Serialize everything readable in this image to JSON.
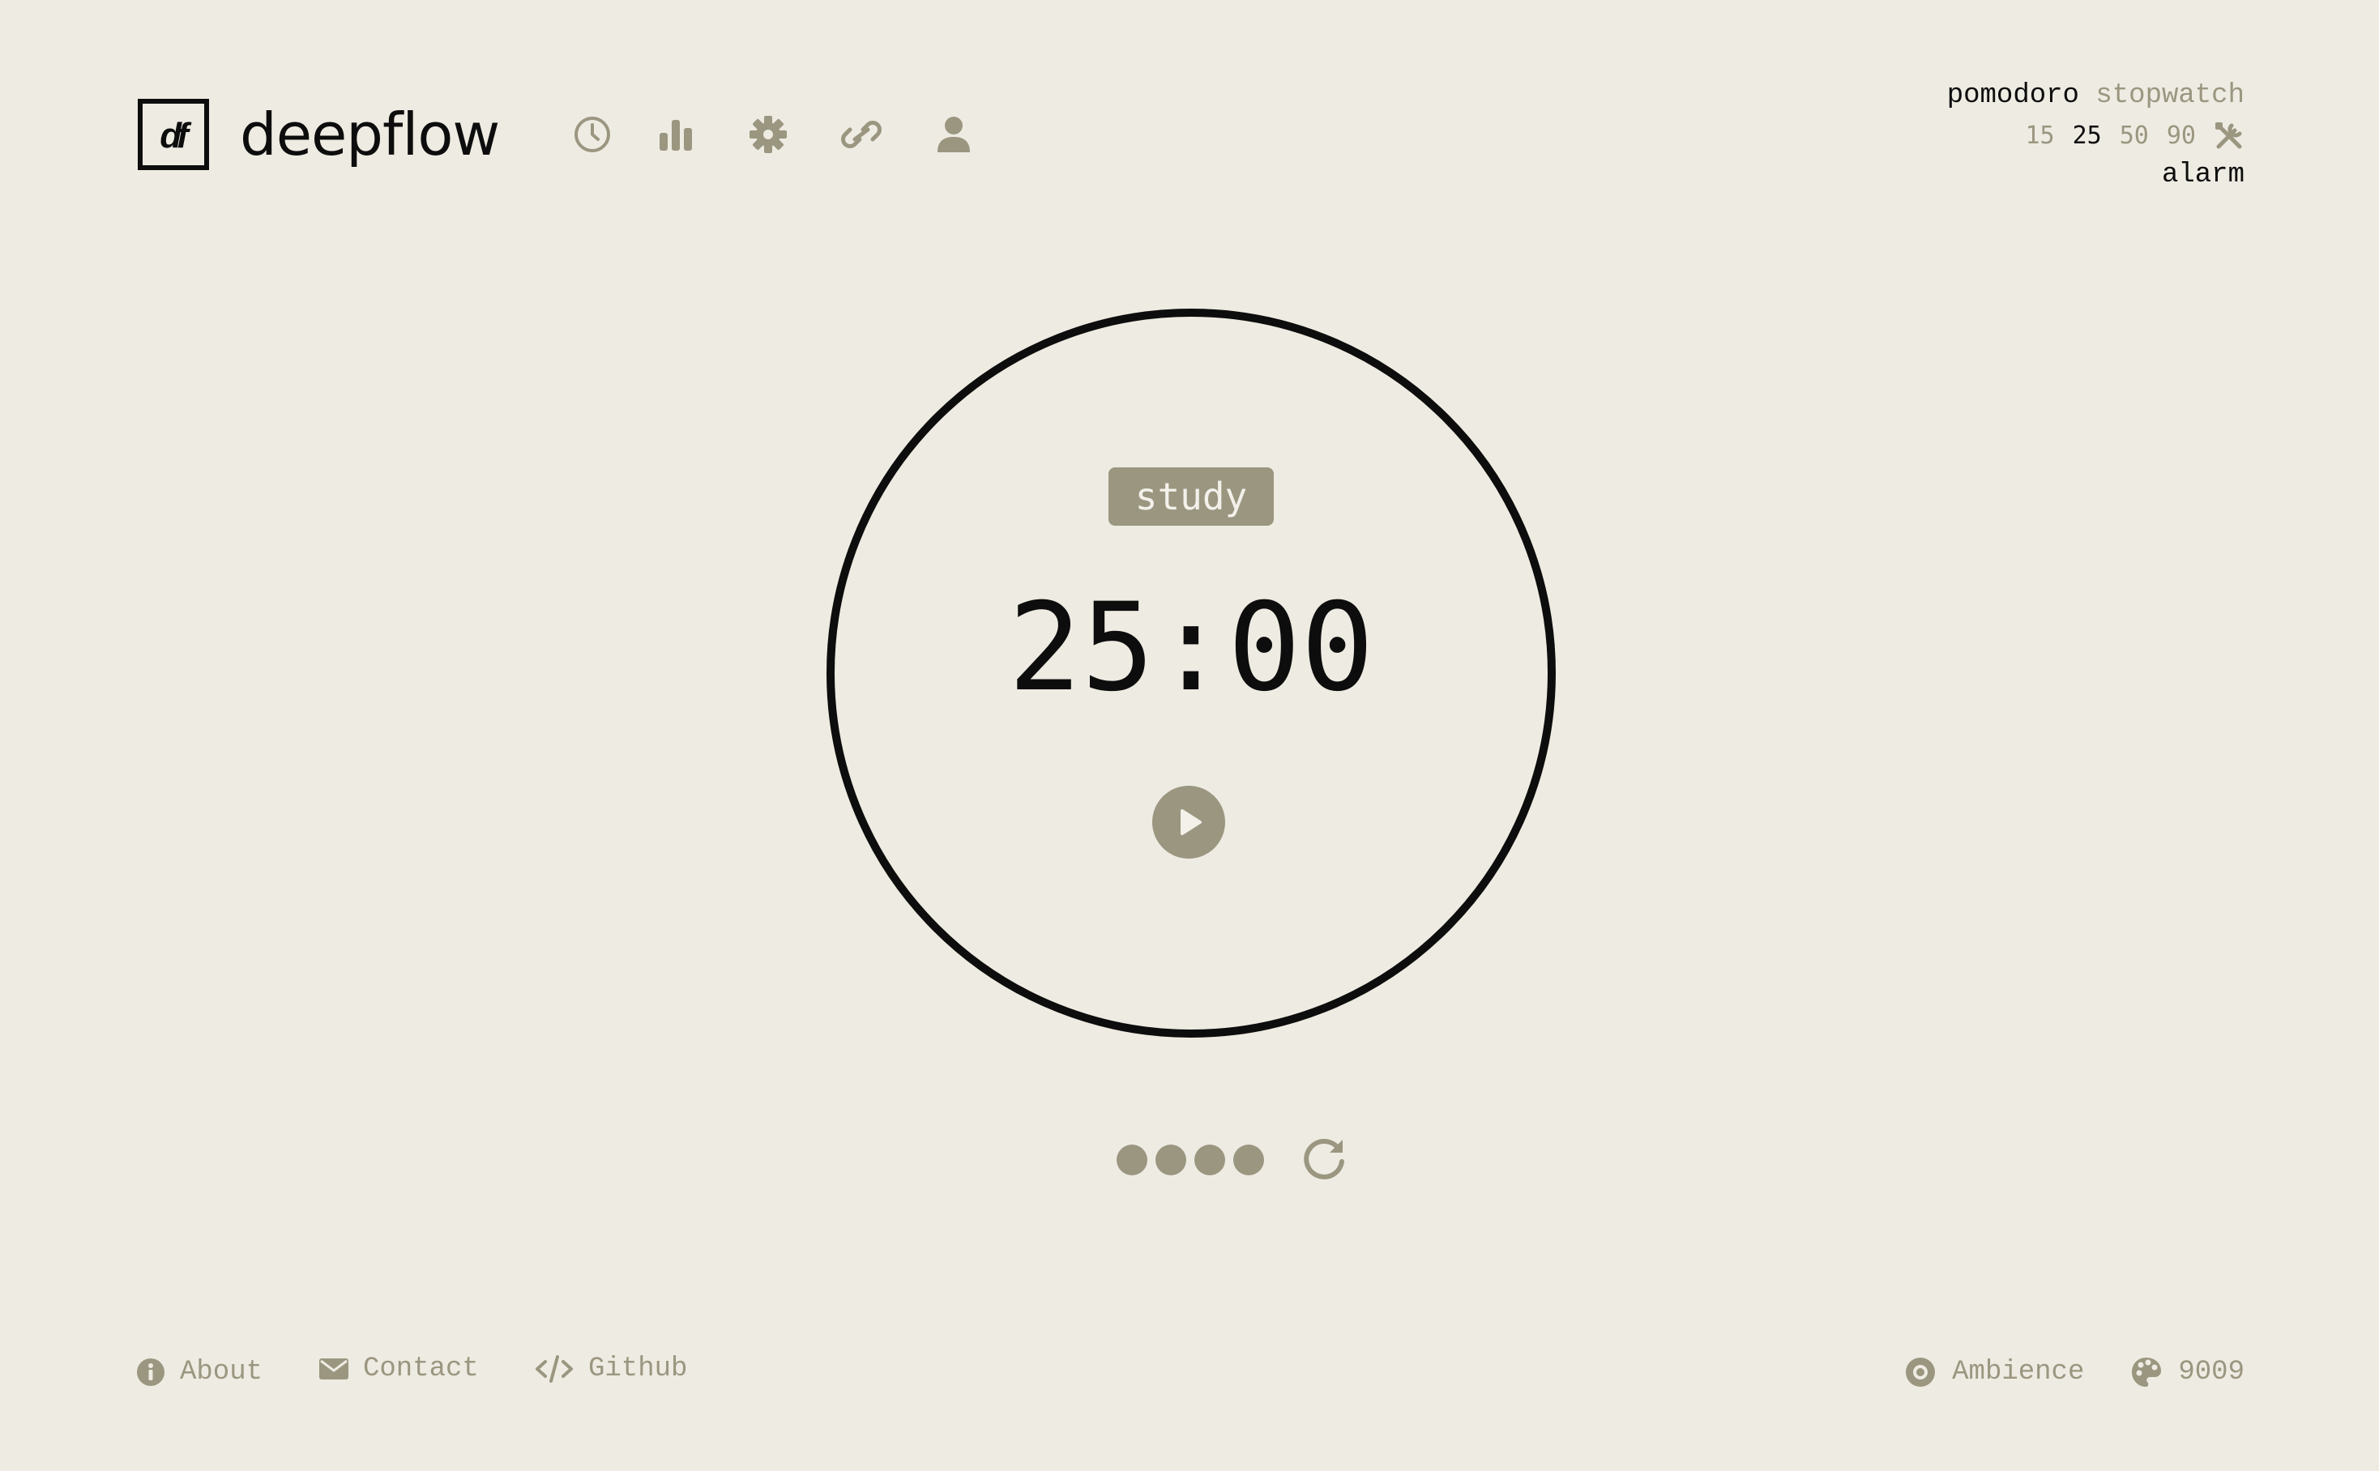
{
  "header": {
    "logo_text": "df",
    "app_name": "deepflow",
    "nav": [
      {
        "icon": "clock-icon"
      },
      {
        "icon": "bar-chart-icon"
      },
      {
        "icon": "gear-icon"
      },
      {
        "icon": "link-icon"
      },
      {
        "icon": "user-icon"
      }
    ]
  },
  "modes": {
    "active": "pomodoro",
    "inactive": "stopwatch",
    "durations": [
      "15",
      "25",
      "50",
      "90"
    ],
    "active_duration": "25",
    "custom_icon": "tools-icon",
    "alarm_label": "alarm"
  },
  "timer": {
    "session_label": "study",
    "time": "25:00",
    "play_icon": "play-icon",
    "sessions_total": 4,
    "reset_icon": "reset-icon"
  },
  "footer": {
    "about_label": "About",
    "contact_label": "Contact",
    "github_label": "Github",
    "ambience_label": "Ambience",
    "theme_label": "9009"
  },
  "colors": {
    "background": "#eeebe2",
    "text": "#0d0d0d",
    "accent": "#9a9680"
  }
}
